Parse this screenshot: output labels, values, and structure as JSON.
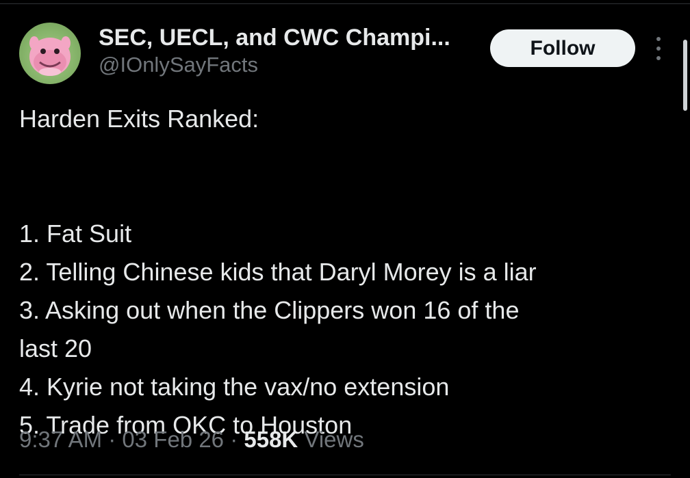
{
  "author": {
    "display_name": "SEC, UECL, and CWC Champi...",
    "handle": "@IOnlySayFacts",
    "avatar_icon": "pink-pokemon-avatar"
  },
  "actions": {
    "follow_label": "Follow",
    "more_icon": "more-vertical-icon"
  },
  "tweet": {
    "heading": "Harden Exits Ranked:",
    "lines": [
      "1. Fat Suit",
      "2. Telling Chinese kids that Daryl Morey is a liar",
      "3. Asking out when the Clippers won 16 of the",
      "last 20",
      "4. Kyrie not taking the vax/no extension",
      "5. Trade from OKC to Houston"
    ]
  },
  "meta": {
    "time": "9:37 AM",
    "separator": " · ",
    "date": "03 Feb 26",
    "views_count": "558K",
    "views_label": " Views"
  },
  "colors": {
    "background": "#000000",
    "primary_text": "#e7e9ea",
    "secondary_text": "#71767b",
    "follow_button_bg": "#eff3f4",
    "follow_button_text": "#0f1419"
  }
}
